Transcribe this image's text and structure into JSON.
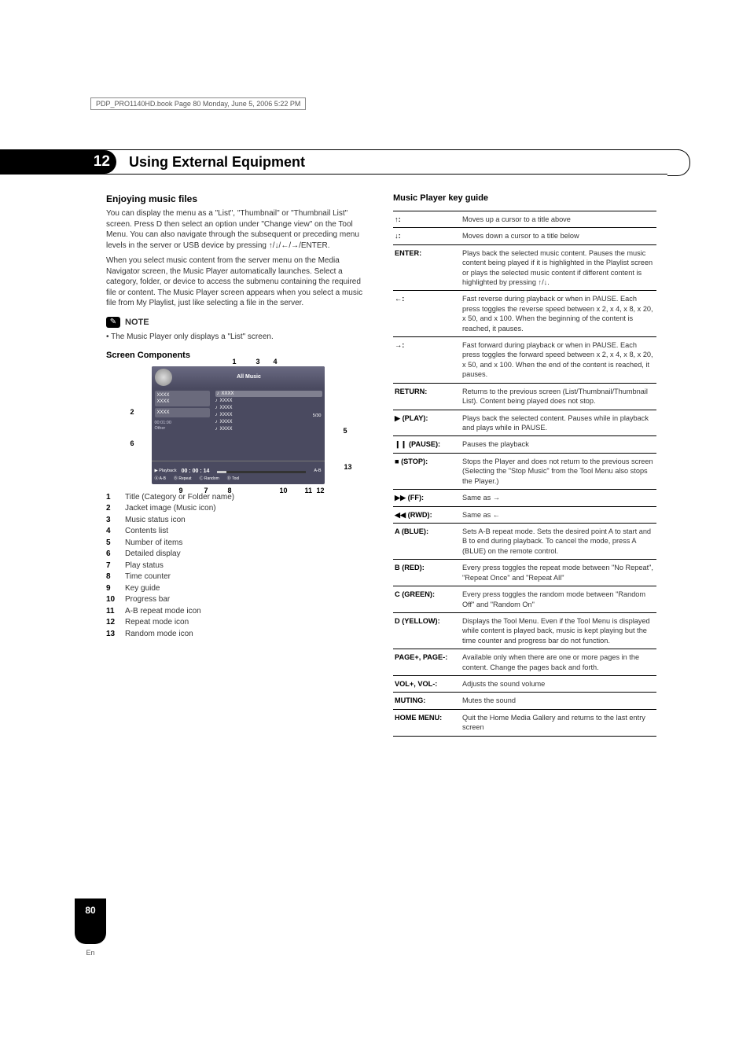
{
  "header_line": "PDP_PRO1140HD.book  Page 80  Monday, June 5, 2006  5:22 PM",
  "chapter": {
    "number": "12",
    "title": "Using External Equipment"
  },
  "left": {
    "section_title": "Enjoying music files",
    "para1": "You can display the menu as a \"List\", \"Thumbnail\" or \"Thumbnail List\" screen. Press D then select an option under \"Change view\" on the Tool Menu. You can also navigate through the subsequent or preceding menu levels in the server or USB device by pressing ↑/↓/←/→/ENTER.",
    "para2": "When you select music content from the server menu on the Media Navigator screen, the Music Player automatically launches. Select a category, folder, or device to access the submenu containing the required file or content. The Music Player screen appears when you select a music file from My Playlist, just like selecting a file in the server.",
    "note_label": "NOTE",
    "note_body": "• The Music Player only displays a \"List\" screen.",
    "screen_components_title": "Screen Components",
    "ss": {
      "title": "All Music",
      "list_item": "XXXX",
      "sub_item": "XXXX",
      "meta1": "00:01:00",
      "meta2": "Other",
      "time": "00 : 00 : 14",
      "count": "5/30",
      "ab_label": "A-B",
      "bottom_playback": "▶ Playback",
      "bottom_ab": "A-B",
      "bottom_repeat": "Repeat",
      "bottom_random": "Random",
      "bottom_tool": "Tool"
    },
    "callouts": {
      "c1": "1",
      "c2": "2",
      "c3": "3",
      "c4": "4",
      "c5": "5",
      "c6": "6",
      "c7": "7",
      "c8": "8",
      "c9": "9",
      "c10": "10",
      "c11": "11",
      "c12": "12",
      "c13": "13"
    },
    "legend": [
      {
        "n": "1",
        "t": "Title (Category or Folder name)"
      },
      {
        "n": "2",
        "t": "Jacket image (Music icon)"
      },
      {
        "n": "3",
        "t": "Music status icon"
      },
      {
        "n": "4",
        "t": "Contents list"
      },
      {
        "n": "5",
        "t": "Number of items"
      },
      {
        "n": "6",
        "t": "Detailed display"
      },
      {
        "n": "7",
        "t": "Play status"
      },
      {
        "n": "8",
        "t": "Time counter"
      },
      {
        "n": "9",
        "t": "Key guide"
      },
      {
        "n": "10",
        "t": "Progress bar"
      },
      {
        "n": "11",
        "t": "A-B repeat mode icon"
      },
      {
        "n": "12",
        "t": "Repeat mode icon"
      },
      {
        "n": "13",
        "t": "Random mode icon"
      }
    ]
  },
  "right": {
    "title": "Music Player key guide",
    "rows": [
      {
        "k": "↑:",
        "d": "Moves up a cursor to a title above"
      },
      {
        "k": "↓:",
        "d": "Moves down a cursor to a title below"
      },
      {
        "k": "ENTER:",
        "d": "Plays back the selected music content. Pauses the music content being played if it is highlighted in the Playlist screen or plays the selected music content if different content is highlighted by pressing ↑/↓."
      },
      {
        "k": "←:",
        "d": "Fast reverse during playback or when in PAUSE. Each press toggles the reverse speed between x 2, x 4, x 8, x 20, x 50, and x 100. When the beginning of the content is reached, it pauses."
      },
      {
        "k": "→:",
        "d": "Fast forward during playback or when in PAUSE. Each press toggles the forward speed between x 2, x 4, x 8, x 20, x 50, and x 100. When the end of the content is reached, it pauses."
      },
      {
        "k": "RETURN:",
        "d": "Returns to the previous screen (List/Thumbnail/Thumbnail List). Content being played does not stop."
      },
      {
        "k": "▶ (PLAY):",
        "d": "Plays back the selected content. Pauses while in playback and plays while in PAUSE."
      },
      {
        "k": "❙❙ (PAUSE):",
        "d": "Pauses the playback"
      },
      {
        "k": "■ (STOP):",
        "d": "Stops the Player and does not return to the previous screen (Selecting the \"Stop Music\" from the Tool Menu also stops the Player.)"
      },
      {
        "k": "▶▶ (FF):",
        "d": "Same as →"
      },
      {
        "k": "◀◀ (RWD):",
        "d": "Same as ←"
      },
      {
        "k": "A (BLUE):",
        "d": "Sets A-B repeat mode. Sets the desired point A to start and B to end during playback. To cancel the mode, press A (BLUE) on the remote control."
      },
      {
        "k": "B (RED):",
        "d": "Every press toggles the repeat mode between \"No Repeat\", \"Repeat Once\" and \"Repeat All\""
      },
      {
        "k": "C (GREEN):",
        "d": "Every press toggles the random mode between \"Random Off\" and \"Random On\""
      },
      {
        "k": "D (YELLOW):",
        "d": "Displays the Tool Menu. Even if the Tool Menu is displayed while content is played back, music is kept playing but the time counter and progress bar do not function."
      },
      {
        "k": "PAGE+, PAGE-:",
        "d": "Available only when there are one or more pages in the content.  Change the pages back and forth."
      },
      {
        "k": "VOL+, VOL-:",
        "d": "Adjusts the sound volume"
      },
      {
        "k": "MUTING:",
        "d": "Mutes the sound"
      },
      {
        "k": "HOME MENU:",
        "d": "Quit the Home Media Gallery and returns to the last entry screen"
      }
    ]
  },
  "page": {
    "number": "80",
    "lang": "En"
  }
}
